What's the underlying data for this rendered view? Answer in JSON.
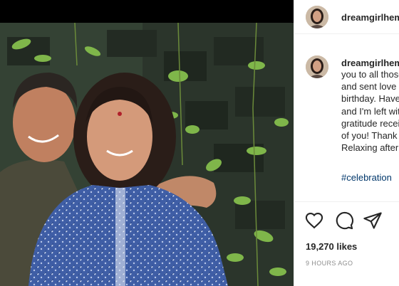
{
  "post": {
    "username": "dreamgirlhemamalini",
    "caption_lines": [
      "you to all those",
      "and sent love an",
      "birthday. Have r",
      "and I'm left with",
      "gratitude receiv",
      "of you! Thank y",
      "Relaxing after a"
    ],
    "hashtag": "#celebration",
    "likes": "19,270 likes",
    "timestamp": "9 HOURS AGO"
  },
  "icons": {
    "like": "heart-icon",
    "comment": "comment-bubble-icon",
    "share": "paper-plane-icon"
  },
  "colors": {
    "link": "#00376b",
    "meta_gray": "#8e8e8e",
    "text": "#262626"
  }
}
